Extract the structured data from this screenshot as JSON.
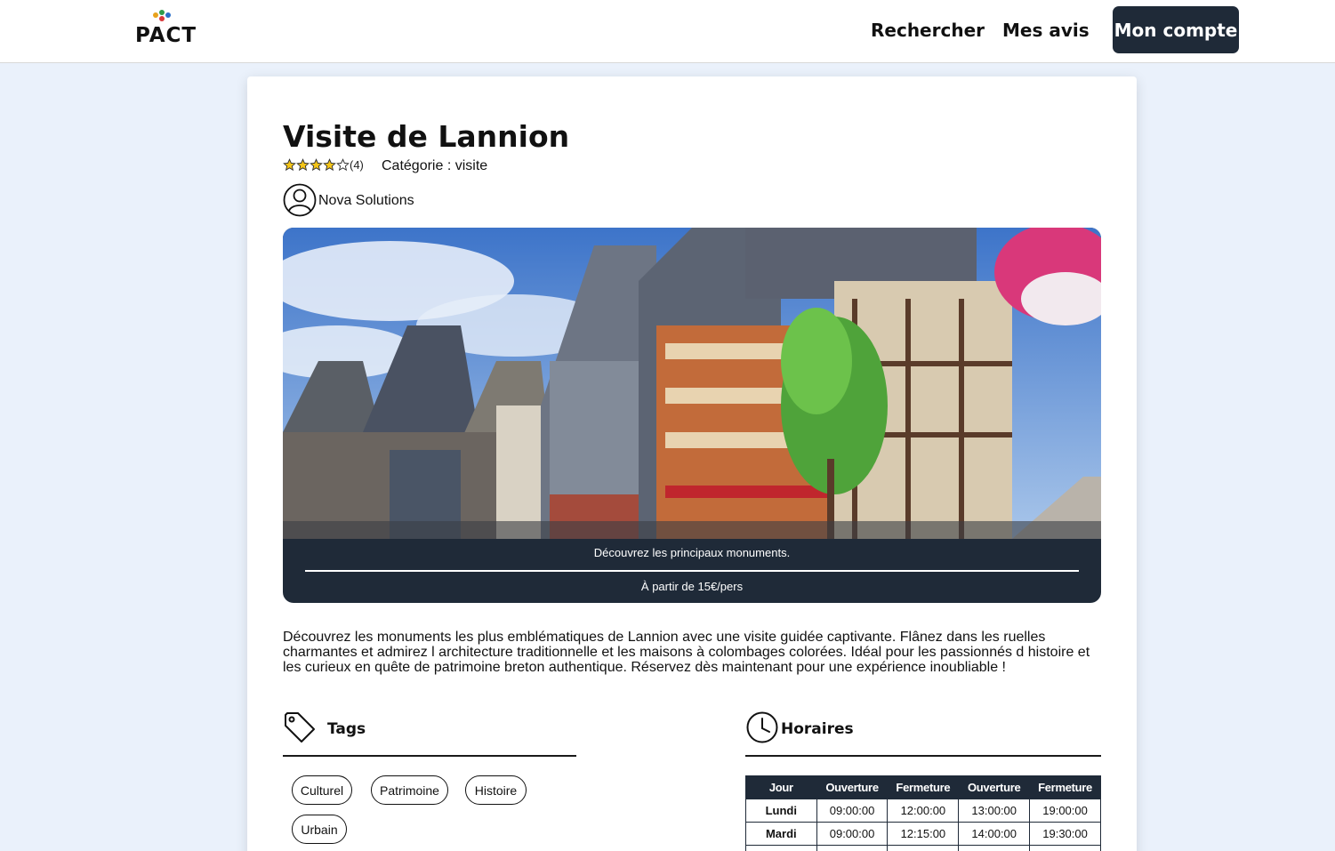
{
  "header": {
    "logo_text": "PACT",
    "nav": {
      "search": "Rechercher",
      "reviews": "Mes avis",
      "account": "Mon compte"
    }
  },
  "offer": {
    "title": "Visite de Lannion",
    "rating": 4,
    "rating_count": "(4)",
    "category": "Catégorie : visite",
    "author": "Nova Solutions",
    "caption": "Découvrez les principaux monuments.",
    "price": "À partir de 15€/pers",
    "description": "Découvrez les monuments les plus emblématiques de Lannion avec une visite guidée captivante. Flânez dans les ruelles charmantes et admirez l architecture traditionnelle et les maisons à colombages colorées. Idéal pour les passionnés d histoire et les curieux en quête de patrimoine breton authentique. Réservez dès maintenant pour une expérience inoubliable !"
  },
  "tags": {
    "title": "Tags",
    "items": [
      "Culturel",
      "Patrimoine",
      "Histoire",
      "Urbain"
    ]
  },
  "hours": {
    "title": "Horaires",
    "columns": [
      "Jour",
      "Ouverture",
      "Fermeture",
      "Ouverture",
      "Fermeture"
    ],
    "rows": [
      [
        "Lundi",
        "09:00:00",
        "12:00:00",
        "13:00:00",
        "19:00:00"
      ],
      [
        "Mardi",
        "09:00:00",
        "12:15:00",
        "14:00:00",
        "19:30:00"
      ]
    ]
  },
  "colors": {
    "dark": "#1f2a38",
    "background": "#eaf1fb",
    "star": "#f5c518"
  }
}
